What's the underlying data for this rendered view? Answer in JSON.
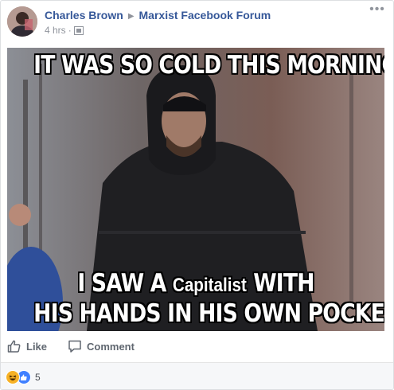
{
  "post": {
    "author": "Charles Brown",
    "group": "Marxist Facebook Forum",
    "time": "4 hrs",
    "dot": "·",
    "more_label": "•••",
    "privacy_icon": "public-icon"
  },
  "meme": {
    "top_text": "IT WAS SO COLD THIS MORNING",
    "mid_prefix": "I SAW A",
    "mid_word": "Capitalist",
    "mid_suffix": "WITH",
    "bottom_text": "HIS HANDS IN HIS OWN POCKETS"
  },
  "actions": {
    "like_label": "Like",
    "comment_label": "Comment"
  },
  "reactions": {
    "types": [
      "haha-icon",
      "like-icon"
    ],
    "count": "5"
  },
  "colors": {
    "link": "#365899",
    "meta": "#90949c",
    "like_blue": "#4080ff",
    "haha_yellow": "#f7b125"
  }
}
